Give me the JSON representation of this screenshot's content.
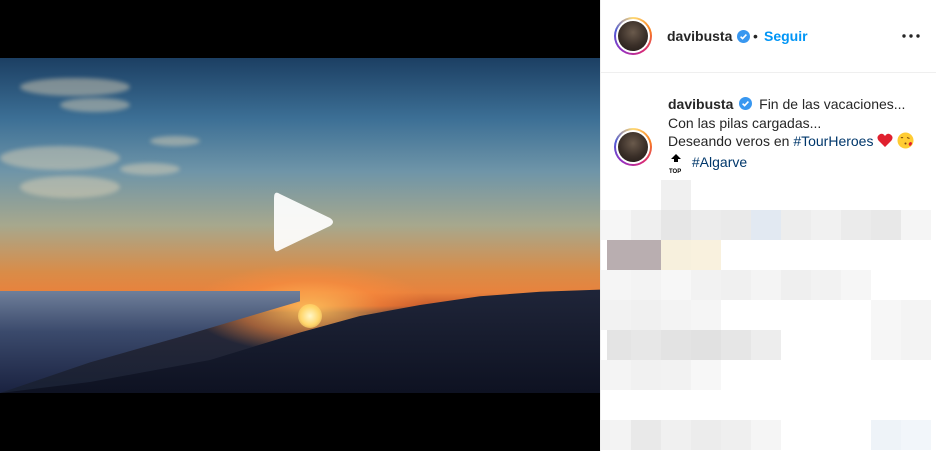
{
  "post": {
    "username": "davibusta",
    "separator": "•",
    "follow_label": "Seguir",
    "caption_lines": [
      "Fin de las vacaciones...",
      "Con las pilas cargadas...",
      "Deseando veros en "
    ],
    "hashtag_tourheroes": "#TourHeroes",
    "top_label": "TOP",
    "hashtag_algarve": "#Algarve"
  },
  "icons": {
    "play": "play-icon",
    "verified": "verified-badge-icon",
    "more": "more-options-icon",
    "heart": "red-heart-emoji",
    "kiss": "kiss-face-emoji",
    "top": "top-arrow-emoji"
  },
  "colors": {
    "follow": "#0095f6",
    "hashtag": "#00376b",
    "verified": "#3897f0",
    "text": "#262626"
  }
}
